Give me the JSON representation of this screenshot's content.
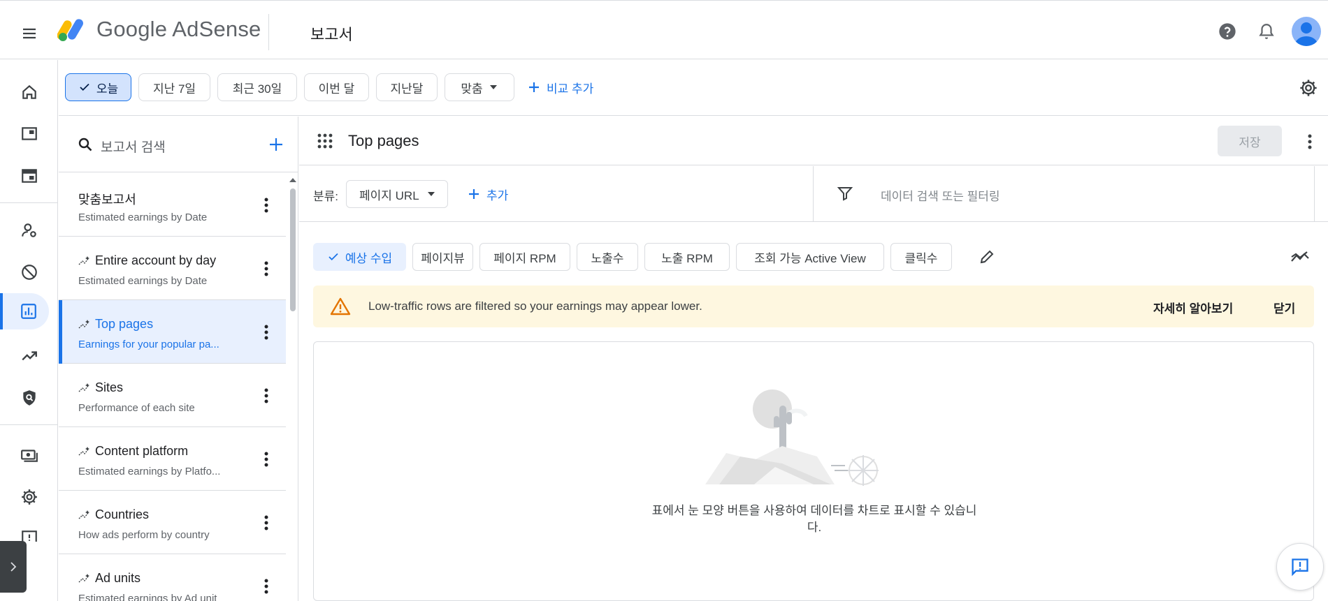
{
  "header": {
    "logo_text": "Google AdSense",
    "page_title": "보고서"
  },
  "datebar": {
    "chips": [
      "오늘",
      "지난 7일",
      "최근 30일",
      "이번 달",
      "지난달",
      "맞춤"
    ],
    "selected": "오늘",
    "compare_label": "비교 추가"
  },
  "report_list": {
    "search_placeholder": "보고서 검색",
    "items": [
      {
        "title": "맞춤보고서",
        "subtitle": "Estimated earnings by Date",
        "icon": ""
      },
      {
        "title": "Entire account by day",
        "subtitle": "Estimated earnings by Date",
        "icon": "auto-report-icon"
      },
      {
        "title": "Top pages",
        "subtitle": "Earnings for your popular pa...",
        "icon": "auto-report-icon"
      },
      {
        "title": "Sites",
        "subtitle": "Performance of each site",
        "icon": "auto-report-icon"
      },
      {
        "title": "Content platform",
        "subtitle": "Estimated earnings by Platfo...",
        "icon": "auto-report-icon"
      },
      {
        "title": "Countries",
        "subtitle": "How ads perform by country",
        "icon": "auto-report-icon"
      },
      {
        "title": "Ad units",
        "subtitle": "Estimated earnings by Ad unit",
        "icon": "auto-report-icon"
      }
    ],
    "active_index": 2
  },
  "main": {
    "title": "Top pages",
    "save_label": "저장",
    "filter": {
      "label": "분류:",
      "dimension": "페이지 URL",
      "add_label": "추가",
      "search_placeholder": "데이터 검색 또는 필터링"
    },
    "metrics": [
      "예상 수입",
      "페이지뷰",
      "페이지 RPM",
      "노출수",
      "노출 RPM",
      "조회 가능 Active View",
      "클릭수"
    ],
    "selected_metric": "예상 수입",
    "banner": {
      "text": "Low-traffic rows are filtered so your earnings may appear lower.",
      "learn_more": "자세히 알아보기",
      "dismiss": "닫기"
    },
    "empty_state": {
      "line1": "표에서 눈 모양 버튼을 사용하여 데이터를 차트로 표시할 수 있습니",
      "line2": "다."
    }
  },
  "colors": {
    "accent": "#1a73e8",
    "banner_bg": "#fef7e0",
    "warning": "#e37400"
  }
}
